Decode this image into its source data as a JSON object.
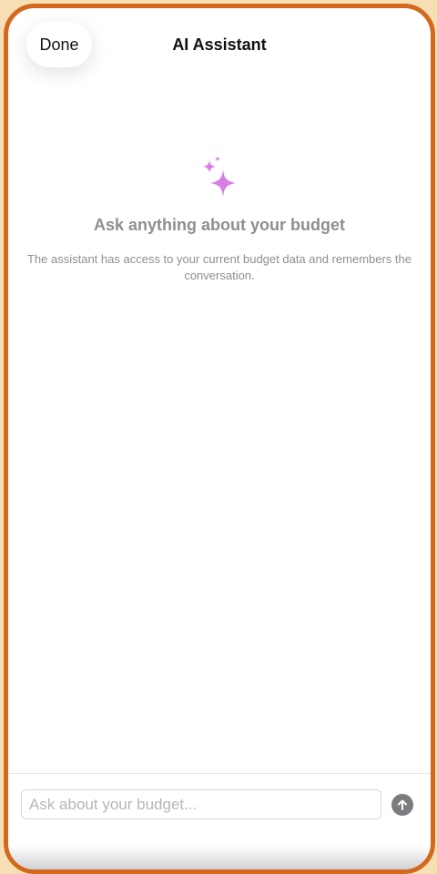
{
  "header": {
    "done_label": "Done",
    "title": "AI Assistant"
  },
  "empty_state": {
    "icon": "sparkles-icon",
    "heading": "Ask anything about your budget",
    "subtitle": "The assistant has access to your current budget data and remembers the conversation."
  },
  "composer": {
    "placeholder": "Ask about your budget...",
    "value": "",
    "send_icon": "arrow-up-icon"
  },
  "colors": {
    "frame": "#d2691e",
    "sparkle": "#d77ee0",
    "muted_text": "#8e8e93",
    "send_button": "#7c7c80"
  }
}
